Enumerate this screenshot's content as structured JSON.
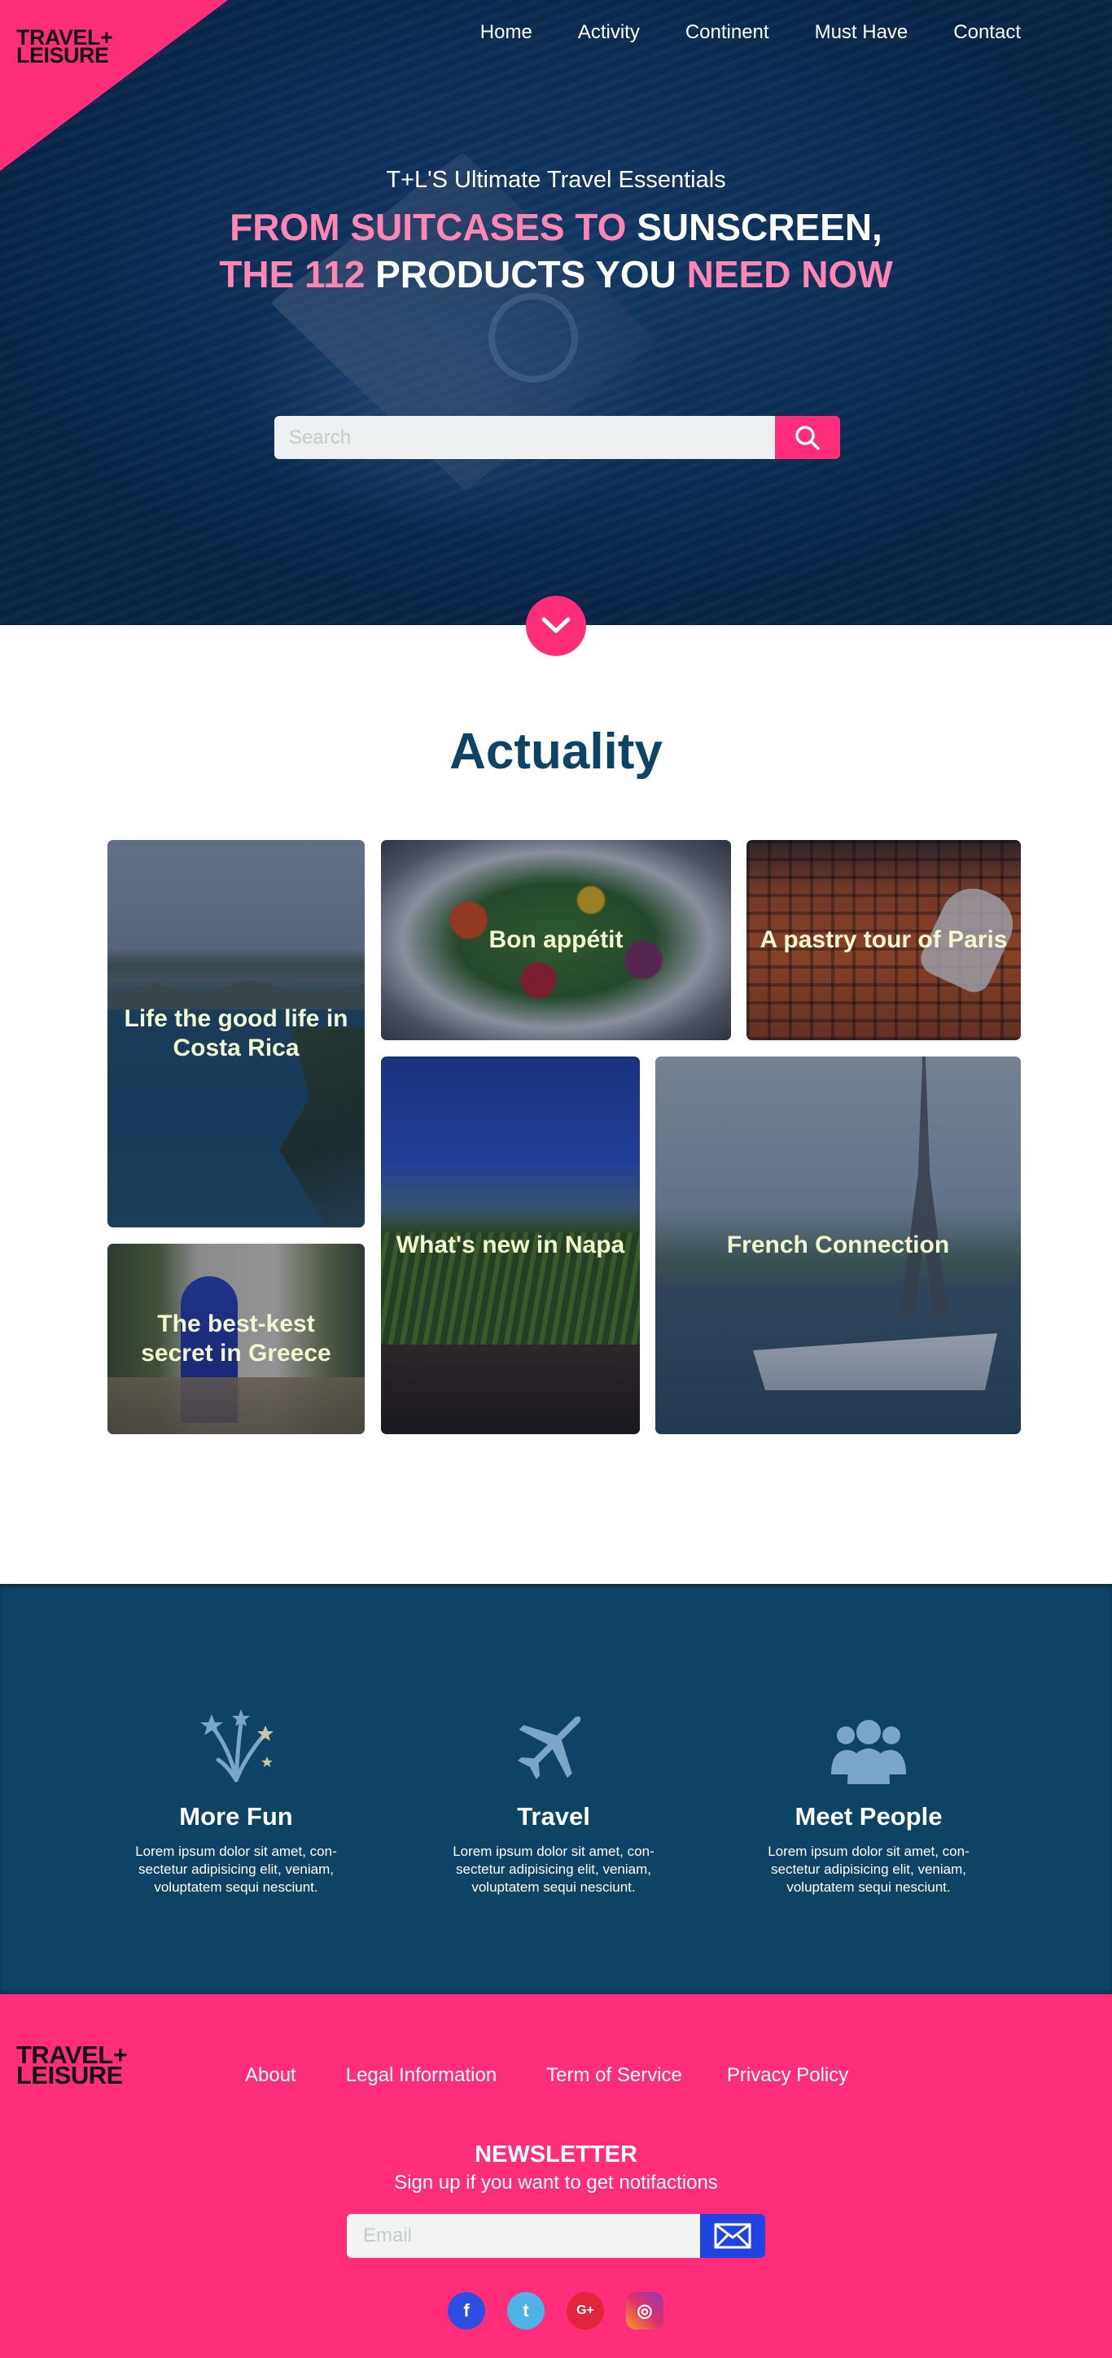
{
  "brand": {
    "logo_line1": "TRAVEL+",
    "logo_line2": "LEISURE"
  },
  "nav": [
    "Home",
    "Activity",
    "Continent",
    "Must Have",
    "Contact"
  ],
  "hero": {
    "kicker": "T+L'S Ultimate Travel Essentials",
    "headline_part1": "FROM SUITCASES TO ",
    "headline_part2": "SUNSCREEN,",
    "headline_part3": "THE 112 ",
    "headline_part4": "PRODUCTS YOU ",
    "headline_part5": "NEED NOW",
    "search_placeholder": "Search"
  },
  "actuality": {
    "title": "Actuality",
    "tiles": [
      "Life the good life in Costa Rica",
      "Bon appétit",
      "A pastry tour of Paris",
      "The best-kest secret in Greece",
      "What's new in Napa",
      "French Connection"
    ]
  },
  "features": [
    {
      "icon": "fireworks-icon",
      "title": "More Fun",
      "text": "Lorem ipsum dolor sit amet, con-sectetur adipisicing elit, veniam, voluptatem sequi nesciunt."
    },
    {
      "icon": "airplane-icon",
      "title": "Travel",
      "text": "Lorem ipsum dolor sit amet, con-sectetur adipisicing elit, veniam, voluptatem sequi nesciunt."
    },
    {
      "icon": "people-icon",
      "title": "Meet People",
      "text": "Lorem ipsum dolor sit amet, con-sectetur adipisicing elit, veniam, voluptatem sequi nesciunt."
    }
  ],
  "footer": {
    "links": [
      "About",
      "Legal Information",
      "Term of Service",
      "Privacy Policy"
    ],
    "newsletter_title": "NEWSLETTER",
    "newsletter_text": "Sign up if you want to get notifactions",
    "email_placeholder": "Email",
    "social": [
      {
        "icon": "facebook-icon",
        "glyph": "f"
      },
      {
        "icon": "twitter-icon",
        "glyph": "t"
      },
      {
        "icon": "google-plus-icon",
        "glyph": "G+"
      },
      {
        "icon": "instagram-icon",
        "glyph": "◎"
      }
    ]
  },
  "colors": {
    "accent": "#ff2d7a",
    "navy": "#0d4466",
    "tile_text": "#f3f7cf",
    "headline_pink": "#ff86b3",
    "mail_blue": "#1f44e0"
  }
}
